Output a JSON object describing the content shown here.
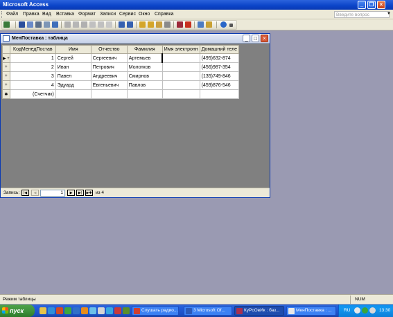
{
  "app": {
    "title": "Microsoft Access"
  },
  "menu": {
    "items": [
      "Файл",
      "Правка",
      "Вид",
      "Вставка",
      "Формат",
      "Записи",
      "Сервис",
      "Окно",
      "Справка"
    ],
    "ask_placeholder": "Введите вопрос"
  },
  "table_window": {
    "title": "МенПоставка : таблица",
    "columns": [
      "КодМенедПостав",
      "Имя",
      "Отчество",
      "Фамилия",
      "Имя электронн",
      "Домашний теле"
    ],
    "rows": [
      [
        "1",
        "Сергей",
        "Сергеевич",
        "Артемьев",
        "",
        "(495)632-874"
      ],
      [
        "2",
        "Иван",
        "Петрович",
        "Молотков",
        "",
        "(456)987-354"
      ],
      [
        "3",
        "Павел",
        "Андреевич",
        "Смирнов",
        "",
        "(135)749-846"
      ],
      [
        "4",
        "Эдуард",
        "Евгеньевич",
        "Павлов",
        "",
        "(459)876-546"
      ]
    ],
    "new_row_placeholder": "(Счетчик)",
    "nav": {
      "label": "Запись:",
      "current": "1",
      "of_text": "из 4"
    }
  },
  "status": {
    "mode": "Режим таблицы",
    "num": "NUM"
  },
  "taskbar": {
    "start": "пуск",
    "tasks": [
      "Слушать радио...",
      "3 Microsoft Of...",
      "КуРсОвИк : баз...",
      "МенПоставка : ..."
    ],
    "lang": "RU",
    "clock": "13:30"
  },
  "colors": {
    "titlebar": "#0b44c8",
    "workspace": "#9a9ab2",
    "child_background": "#808080",
    "chrome": "#ece9d8"
  }
}
